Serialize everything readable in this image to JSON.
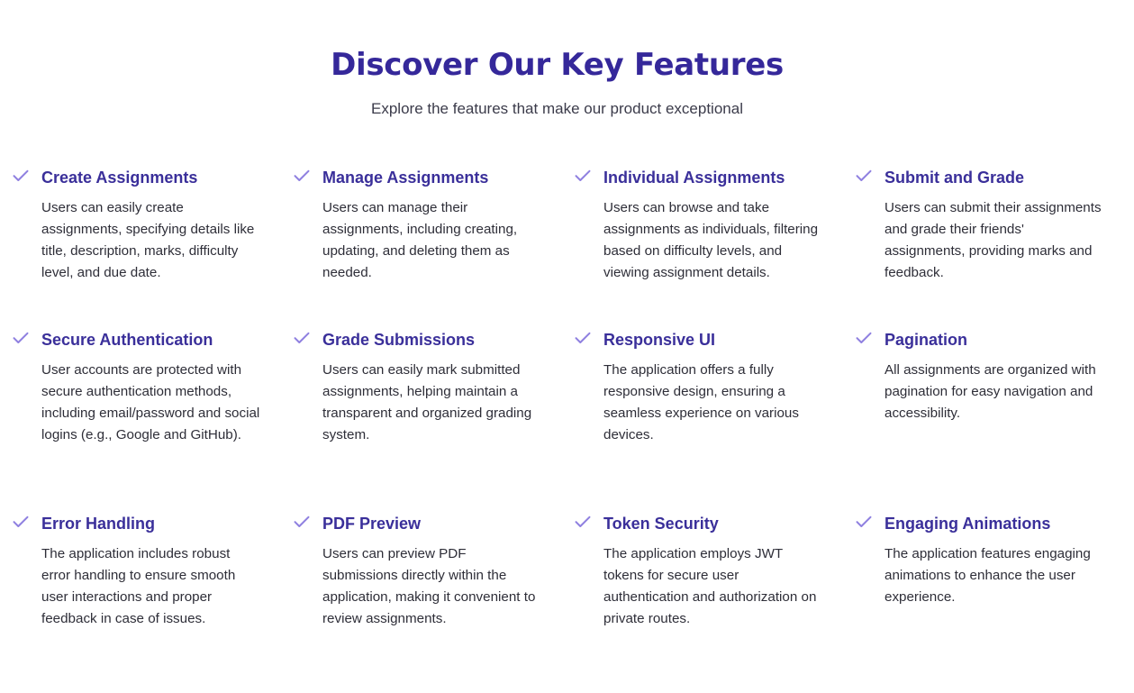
{
  "header": {
    "title": "Discover Our Key Features",
    "subtitle": "Explore the features that make our product exceptional"
  },
  "colors": {
    "title": "#35289a",
    "feature_title": "#3a2f9a",
    "check_icon": "#8f80e0",
    "body_text": "#2e2e38"
  },
  "features": [
    {
      "icon": "check-icon",
      "title": "Create Assignments",
      "description": "Users can easily create assignments, specifying details like title, description, marks, difficulty level, and due date."
    },
    {
      "icon": "check-icon",
      "title": "Manage Assignments",
      "description": "Users can manage their assignments, including creating, updating, and deleting them as needed."
    },
    {
      "icon": "check-icon",
      "title": "Individual Assignments",
      "description": "Users can browse and take assignments as individuals, filtering based on difficulty levels, and viewing assignment details."
    },
    {
      "icon": "check-icon",
      "title": "Submit and Grade",
      "description": "Users can submit their assignments and grade their friends' assignments, providing marks and feedback."
    },
    {
      "icon": "check-icon",
      "title": "Secure Authentication",
      "description": "User accounts are protected with secure authentication methods, including email/password and social logins (e.g., Google and GitHub)."
    },
    {
      "icon": "check-icon",
      "title": "Grade Submissions",
      "description": "Users can easily mark submitted assignments, helping maintain a transparent and organized grading system."
    },
    {
      "icon": "check-icon",
      "title": "Responsive UI",
      "description": "The application offers a fully responsive design, ensuring a seamless experience on various devices."
    },
    {
      "icon": "check-icon",
      "title": "Pagination",
      "description": "All assignments are organized with pagination for easy navigation and accessibility."
    },
    {
      "icon": "check-icon",
      "title": "Error Handling",
      "description": "The application includes robust error handling to ensure smooth user interactions and proper feedback in case of issues."
    },
    {
      "icon": "check-icon",
      "title": "PDF Preview",
      "description": "Users can preview PDF submissions directly within the application, making it convenient to review assignments."
    },
    {
      "icon": "check-icon",
      "title": "Token Security",
      "description": "The application employs JWT tokens for secure user authentication and authorization on private routes."
    },
    {
      "icon": "check-icon",
      "title": "Engaging Animations",
      "description": "The application features engaging animations to enhance the user experience."
    }
  ]
}
